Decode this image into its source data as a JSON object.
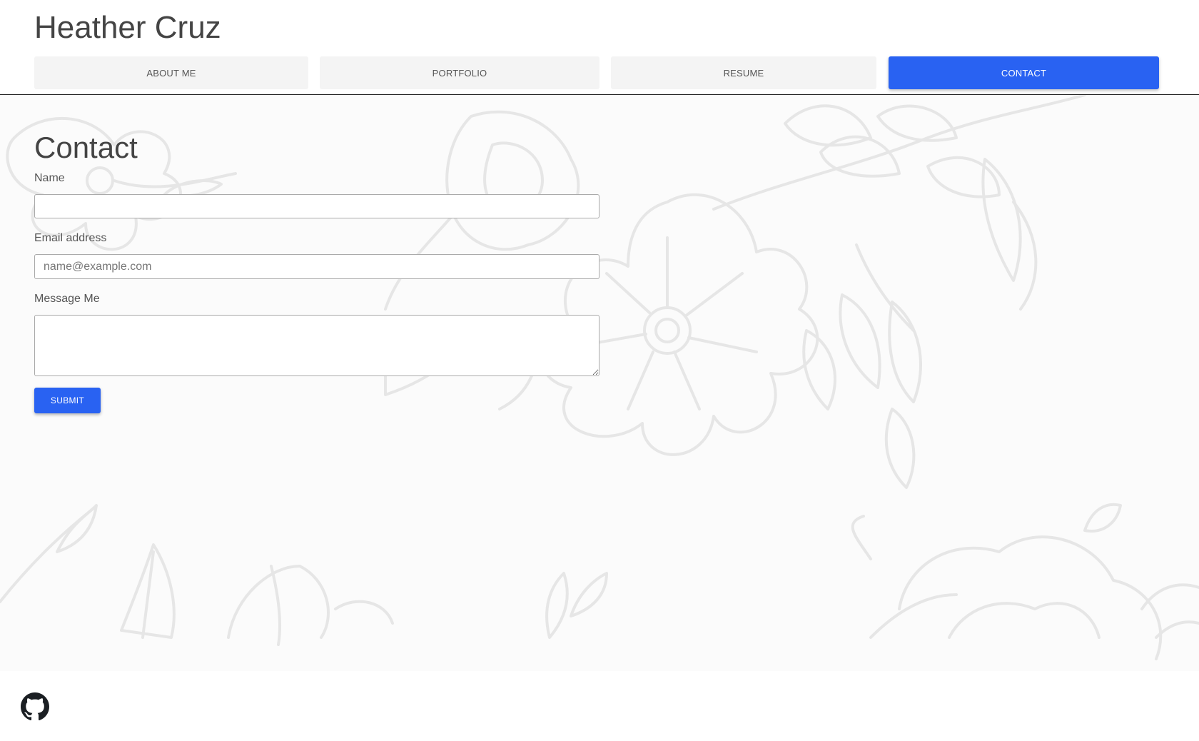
{
  "header": {
    "site_title": "Heather Cruz",
    "nav": [
      {
        "label": "ABOUT ME",
        "active": false
      },
      {
        "label": "PORTFOLIO",
        "active": false
      },
      {
        "label": "RESUME",
        "active": false
      },
      {
        "label": "CONTACT",
        "active": true
      }
    ]
  },
  "contact": {
    "title": "Contact",
    "name_label": "Name",
    "name_value": "",
    "email_label": "Email address",
    "email_placeholder": "name@example.com",
    "email_value": "",
    "message_label": "Message Me",
    "message_value": "",
    "submit_label": "SUBMIT"
  },
  "footer": {
    "github_icon": "github-icon"
  },
  "colors": {
    "accent": "#2962f2",
    "tab_bg": "#f4f4f4",
    "text": "#444444",
    "floral": "#e6e6e6"
  }
}
